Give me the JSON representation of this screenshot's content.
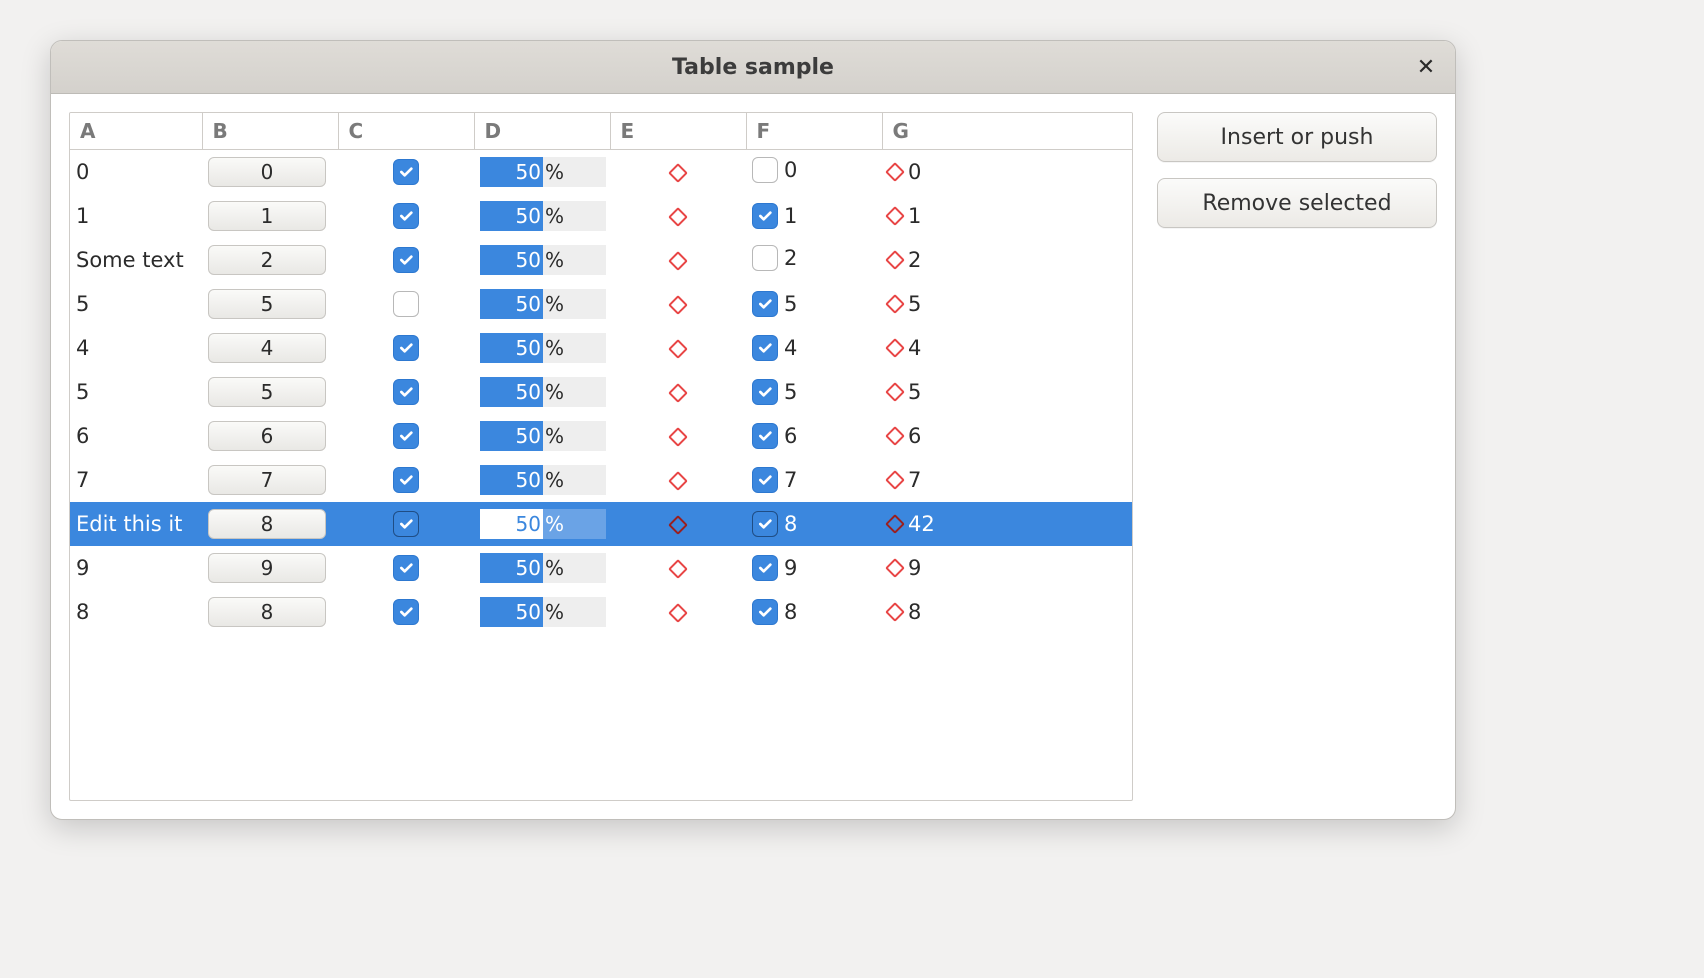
{
  "window": {
    "title": "Table sample",
    "close_glyph": "✕"
  },
  "buttons": {
    "insert": "Insert or push",
    "remove": "Remove selected"
  },
  "table": {
    "columns": [
      "A",
      "B",
      "C",
      "D",
      "E",
      "F",
      "G"
    ],
    "progress_value": "50",
    "progress_suffix": "%",
    "selected_index": 8,
    "rows": [
      {
        "a": "0",
        "b": "0",
        "c": true,
        "f_checked": false,
        "f_label": "0",
        "g": "0"
      },
      {
        "a": "1",
        "b": "1",
        "c": true,
        "f_checked": true,
        "f_label": "1",
        "g": "1"
      },
      {
        "a": "Some text",
        "b": "2",
        "c": true,
        "f_checked": false,
        "f_label": "2",
        "g": "2"
      },
      {
        "a": "5",
        "b": "5",
        "c": false,
        "f_checked": true,
        "f_label": "5",
        "g": "5"
      },
      {
        "a": "4",
        "b": "4",
        "c": true,
        "f_checked": true,
        "f_label": "4",
        "g": "4"
      },
      {
        "a": "5",
        "b": "5",
        "c": true,
        "f_checked": true,
        "f_label": "5",
        "g": "5"
      },
      {
        "a": "6",
        "b": "6",
        "c": true,
        "f_checked": true,
        "f_label": "6",
        "g": "6"
      },
      {
        "a": "7",
        "b": "7",
        "c": true,
        "f_checked": true,
        "f_label": "7",
        "g": "7"
      },
      {
        "a": "Edit this it",
        "b": "8",
        "c": true,
        "f_checked": true,
        "f_label": "8",
        "g": "42"
      },
      {
        "a": "9",
        "b": "9",
        "c": true,
        "f_checked": true,
        "f_label": "9",
        "g": "9"
      },
      {
        "a": "8",
        "b": "8",
        "c": true,
        "f_checked": true,
        "f_label": "8",
        "g": "8"
      }
    ]
  }
}
